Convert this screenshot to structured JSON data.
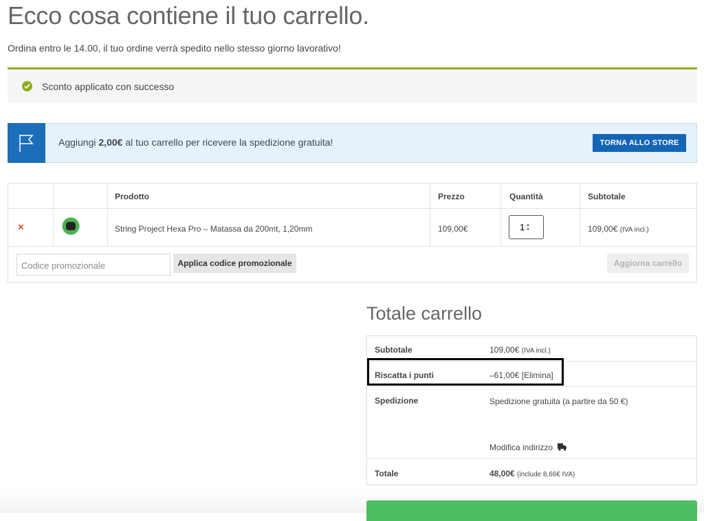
{
  "header": {
    "title": "Ecco cosa contiene il tuo carrello.",
    "subtitle": "Ordina entro le 14.00, il tuo ordine verrà spedito nello stesso giorno lavorativo!"
  },
  "notice": {
    "icon": "check-circle-icon",
    "text": "Sconto applicato con successo",
    "color": "#8fae1b"
  },
  "banner": {
    "icon": "flag-icon",
    "text_before": "Aggiungi ",
    "amount": "2,00€",
    "text_after": " al tuo carrello per ricevere la spedizione gratuita!",
    "button_label": "TORNA ALLO STORE",
    "accent": "#1565b5"
  },
  "cart_table": {
    "headers": {
      "product": "Prodotto",
      "price": "Prezzo",
      "quantity": "Quantità",
      "subtotal": "Subtotale"
    },
    "items": [
      {
        "remove_icon": "×",
        "name": "String Project Hexa Pro – Matassa da 200mt, 1,20mm",
        "price": "109,00€",
        "quantity": "1",
        "subtotal": "109,00€",
        "subtotal_note": "(IVA incl.)"
      }
    ],
    "promo_placeholder": "Codice promozionale",
    "promo_button": "Applica codice promozionale",
    "update_button": "Aggiorna carrello"
  },
  "totals": {
    "title": "Totale carrello",
    "subtotal_label": "Subtotale",
    "subtotal_value": "109,00€",
    "subtotal_note": "(IVA incl.)",
    "points_label": "Riscatta i punti",
    "points_value": "–61,00€",
    "points_remove": "[Elimina]",
    "shipping_label": "Spedizione",
    "shipping_value": "Spedizione gratuita (a partire da 50 €)",
    "change_address": "Modifica indirizzo",
    "total_label": "Totale",
    "total_value": "48,00€",
    "total_note": "(include 8,66€ IVA)"
  }
}
